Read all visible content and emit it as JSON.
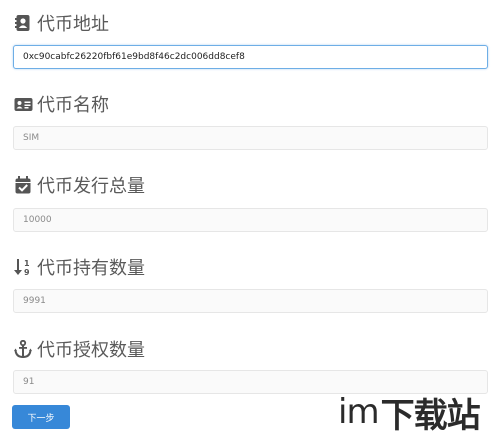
{
  "form": {
    "sections": [
      {
        "label": "代币地址",
        "icon": "contact-book-icon",
        "value": "0xc90cabfc26220fbf61e9bd8f46c2dc006dd8cef8",
        "state": "focused"
      },
      {
        "label": "代币名称",
        "icon": "id-card-icon",
        "value": "SIM",
        "state": "readonly"
      },
      {
        "label": "代币发行总量",
        "icon": "calendar-check-icon",
        "value": "10000",
        "state": "readonly"
      },
      {
        "label": "代币持有数量",
        "icon": "sort-numeric-icon",
        "value": "9991",
        "state": "readonly"
      },
      {
        "label": "代币授权数量",
        "icon": "anchor-icon",
        "value": "91",
        "state": "readonly"
      }
    ],
    "next_button_label": "下一步"
  },
  "watermark": {
    "prefix": "im",
    "text": "下载站"
  },
  "colors": {
    "label_text": "#5a5a5a",
    "icon": "#555555",
    "focus_border": "#6eaee6",
    "button_bg": "#3788d8",
    "button_text": "#ffffff"
  }
}
